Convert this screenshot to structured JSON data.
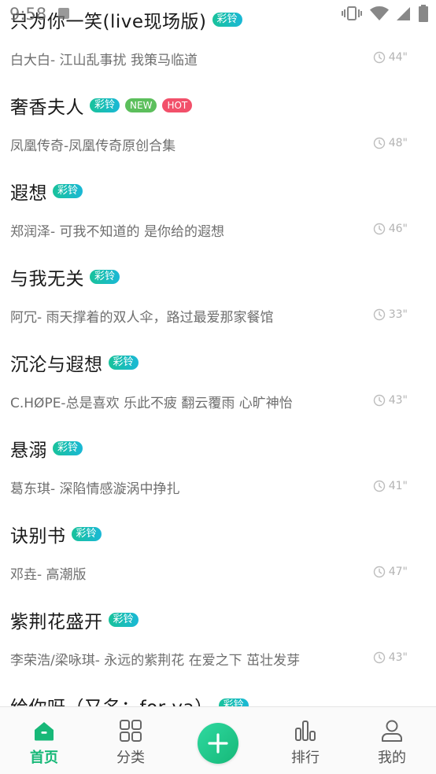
{
  "status_bar": {
    "time": "9:58"
  },
  "songs": [
    {
      "title": "只为你一笑(live现场版)",
      "subtitle": "白大白-  江山乱事扰 我策马临道",
      "duration": "44\"",
      "tags": [
        "彩铃"
      ]
    },
    {
      "title": "奢香夫人",
      "subtitle": "凤凰传奇-凤凰传奇原创合集",
      "duration": "48\"",
      "tags": [
        "彩铃",
        "NEW",
        "HOT"
      ]
    },
    {
      "title": "遐想",
      "subtitle": "郑润泽-  可我不知道的 是你给的遐想",
      "duration": "46\"",
      "tags": [
        "彩铃"
      ]
    },
    {
      "title": "与我无关",
      "subtitle": "阿冗-  雨天撑着的双人伞，路过最爱那家餐馆",
      "duration": "33\"",
      "tags": [
        "彩铃"
      ]
    },
    {
      "title": "沉沦与遐想",
      "subtitle": "C.HØPE-总是喜欢 乐此不疲 翻云覆雨 心旷神怡",
      "duration": "43\"",
      "tags": [
        "彩铃"
      ]
    },
    {
      "title": "悬溺",
      "subtitle": "葛东琪-  深陷情感漩涡中挣扎",
      "duration": "41\"",
      "tags": [
        "彩铃"
      ]
    },
    {
      "title": "诀别书",
      "subtitle": "邓垚-  高潮版",
      "duration": "47\"",
      "tags": [
        "彩铃"
      ]
    },
    {
      "title": "紫荆花盛开",
      "subtitle": "李荣浩/梁咏琪-  永远的紫荆花 在爱之下 茁壮发芽",
      "duration": "43\"",
      "tags": [
        "彩铃"
      ]
    },
    {
      "title": "给你呀（又名：for ya）",
      "subtitle": "",
      "duration": "",
      "tags": [
        "彩铃"
      ]
    }
  ],
  "tag_labels": {
    "ringtone": "彩铃",
    "new": "NEW",
    "hot": "HOT"
  },
  "colors": {
    "accent": "#17b878",
    "ringtone_tag": "#19c29b",
    "new_tag": "#5cbf5c",
    "hot_tag": "#f2506a"
  },
  "bottom_nav": {
    "home": "首页",
    "category": "分类",
    "rank": "排行",
    "mine": "我的",
    "active": "home"
  }
}
